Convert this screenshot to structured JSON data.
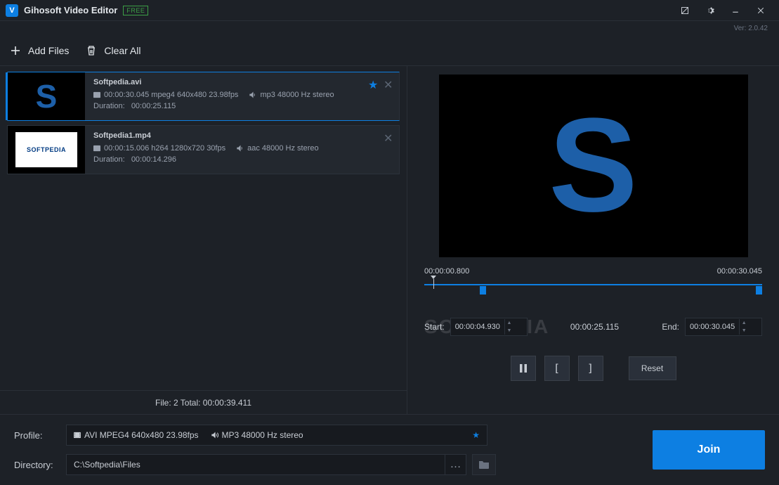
{
  "app": {
    "title": "Gihosoft Video Editor",
    "badge": "FREE",
    "version": "Ver: 2.0.42"
  },
  "toolbar": {
    "add_files": "Add Files",
    "clear_all": "Clear All"
  },
  "files": [
    {
      "name": "Softpedia.avi",
      "video_meta": "00:00:30.045 mpeg4 640x480 23.98fps",
      "audio_meta": "mp3 48000 Hz stereo",
      "duration_label": "Duration:",
      "duration_value": "00:00:25.115",
      "selected": true,
      "starred": true,
      "thumb_type": "s"
    },
    {
      "name": "Softpedia1.mp4",
      "video_meta": "00:00:15.006 h264 1280x720 30fps",
      "audio_meta": "aac 48000 Hz stereo",
      "duration_label": "Duration:",
      "duration_value": "00:00:14.296",
      "selected": false,
      "starred": false,
      "thumb_type": "softpedia"
    }
  ],
  "summary": "File: 2  Total: 00:00:39.411",
  "preview": {
    "current_time": "00:00:00.800",
    "total_time": "00:00:30.045",
    "start_label": "Start:",
    "start_value": "00:00:04.930",
    "mid_value": "00:00:25.115",
    "end_label": "End:",
    "end_value": "00:00:30.045",
    "reset": "Reset",
    "watermark": "SOFTPEDIA"
  },
  "bottom": {
    "profile_label": "Profile:",
    "profile_video": "AVI MPEG4 640x480 23.98fps",
    "profile_audio": "MP3 48000 Hz stereo",
    "directory_label": "Directory:",
    "directory_value": "C:\\Softpedia\\Files",
    "join": "Join"
  }
}
